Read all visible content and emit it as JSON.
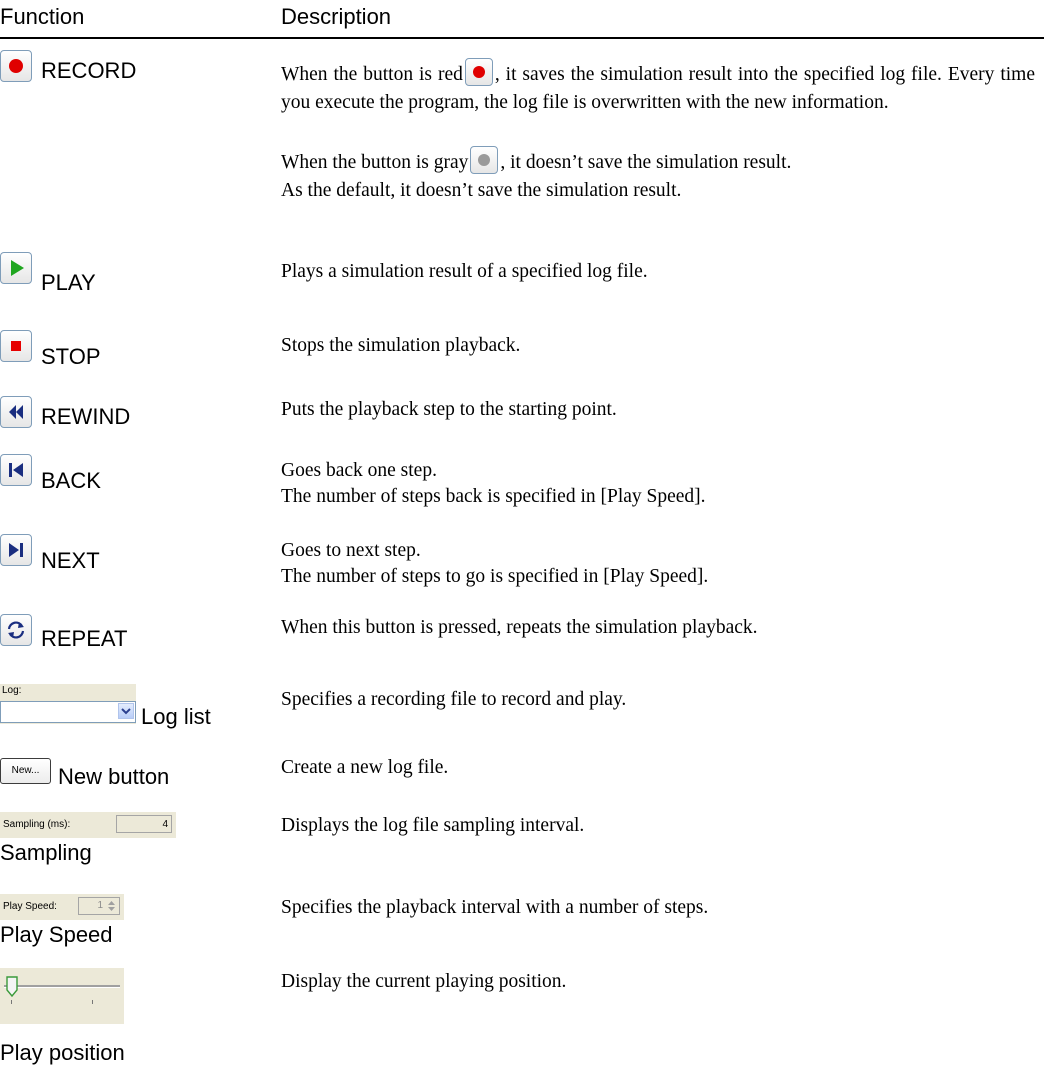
{
  "header": {
    "function": "Function",
    "description": "Description"
  },
  "rows": [
    {
      "name": "RECORD",
      "desc1a": "When the button is red",
      "desc1b": ", it saves the simulation result into the specified log file.  Every time you execute the program, the log file is overwritten   with the new information.",
      "desc2a": "When the button is gray",
      "desc2b": ", it doesn’t save the simulation result.",
      "desc3": "As the default, it doesn’t save the simulation result."
    },
    {
      "name": "PLAY",
      "desc": "Plays a simulation result of a specified log file."
    },
    {
      "name": "STOP",
      "desc": "Stops the simulation playback."
    },
    {
      "name": "REWIND",
      "desc": "Puts the playback step to the starting point."
    },
    {
      "name": "BACK",
      "desc1": "Goes back one step.",
      "desc2": "The number of steps back is specified in [Play Speed]."
    },
    {
      "name": "NEXT",
      "desc1": "Goes to next step.",
      "desc2": "The number of steps to go is specified in [Play Speed]."
    },
    {
      "name": "REPEAT",
      "desc": "When this button is pressed, repeats the simulation playback."
    },
    {
      "name": "Log list",
      "control_label": "Log:",
      "desc": "Specifies a recording file to record and play."
    },
    {
      "name": "New button",
      "control_label": "New...",
      "desc": "Create a new log file."
    },
    {
      "name": "Sampling",
      "control_label": "Sampling (ms):",
      "control_value": "4",
      "desc": "Displays the log file sampling interval."
    },
    {
      "name": "Play Speed",
      "control_label": "Play Speed:",
      "control_value": "1",
      "desc": "Specifies the playback interval with a number of steps."
    },
    {
      "name": "Play position",
      "desc": "Display the current playing position."
    }
  ],
  "icons": [
    "record-icon",
    "play-icon",
    "stop-icon",
    "rewind-icon",
    "back-icon",
    "next-icon",
    "repeat-icon",
    "dropdown-arrow-icon",
    "spinner-arrows-icon",
    "slider-thumb-icon"
  ],
  "colors": {
    "record_red": "#e00000",
    "play_green": "#1fa61f",
    "stop_red": "#e60000",
    "nav_blue": "#1a2e80",
    "control_bg": "#ece9d8"
  }
}
